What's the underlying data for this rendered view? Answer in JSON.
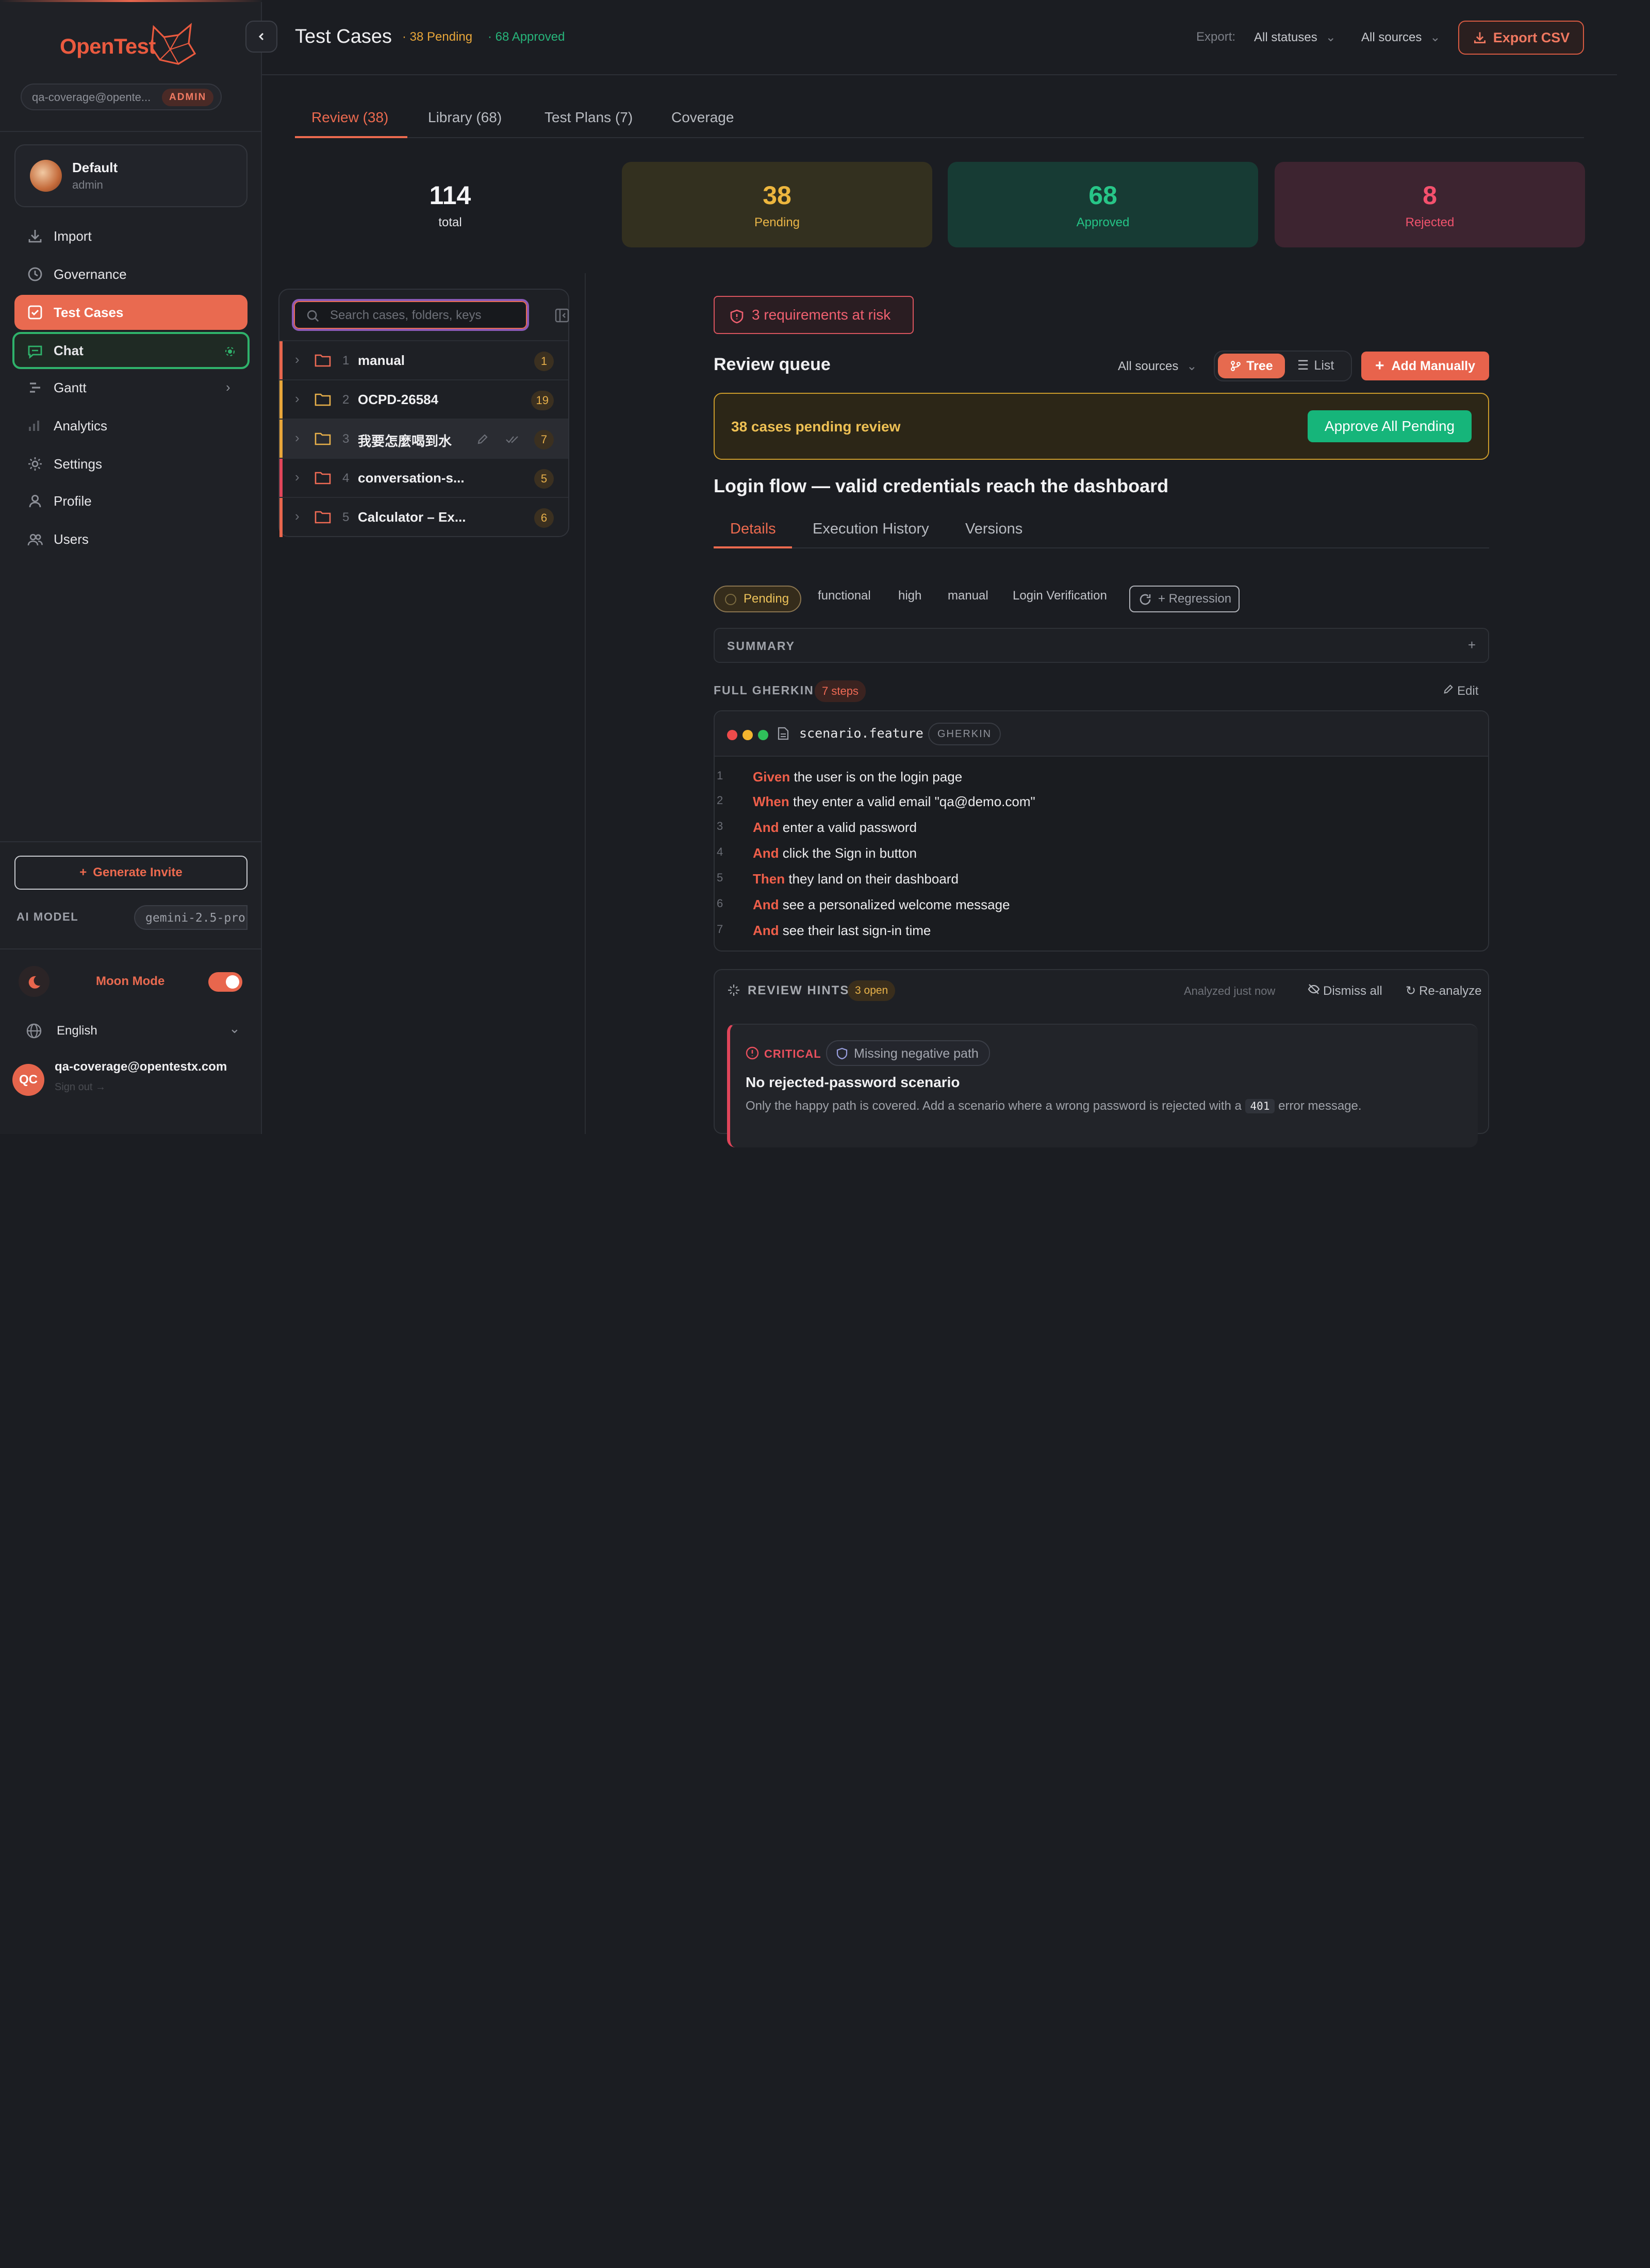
{
  "app": {
    "name": "OpenTest",
    "user_email_short": "qa-coverage@opente...",
    "role_badge": "ADMIN"
  },
  "workspace": {
    "name": "Default",
    "role": "admin"
  },
  "nav": [
    {
      "label": "Import",
      "icon": "download-icon"
    },
    {
      "label": "Governance",
      "icon": "clock-icon"
    },
    {
      "label": "Test Cases",
      "icon": "checkbox-icon"
    },
    {
      "label": "Chat",
      "icon": "chat-icon"
    },
    {
      "label": "Gantt",
      "icon": "gantt-icon"
    },
    {
      "label": "Analytics",
      "icon": "bar-chart-icon"
    },
    {
      "label": "Settings",
      "icon": "gear-icon"
    },
    {
      "label": "Profile",
      "icon": "person-icon"
    },
    {
      "label": "Users",
      "icon": "users-icon"
    }
  ],
  "sidebar_footer": {
    "generate_invite": "Generate Invite",
    "ai_model_label": "AI MODEL",
    "ai_model_value": "gemini-2.5-pro",
    "moon_mode": "Moon Mode",
    "moon_mode_on": true,
    "language": "English",
    "user_initials": "QC",
    "user_email": "qa-coverage@opentestx.com",
    "sign_out": "Sign out →"
  },
  "header": {
    "title": "Test Cases",
    "pending": "· 38 Pending",
    "approved": "· 68 Approved",
    "export_label": "Export:",
    "status_filter": "All statuses",
    "source_filter": "All sources",
    "export_button": "Export CSV"
  },
  "tabs": [
    "Review (38)",
    "Library (68)",
    "Test Plans (7)",
    "Coverage"
  ],
  "stats": [
    {
      "value": "114",
      "label": "total"
    },
    {
      "value": "38",
      "label": "Pending"
    },
    {
      "value": "68",
      "label": "Approved"
    },
    {
      "value": "8",
      "label": "Rejected"
    }
  ],
  "tree": {
    "search_placeholder": "Search cases, folders, keys",
    "folders": [
      {
        "index": "1",
        "name": "manual",
        "count": "1"
      },
      {
        "index": "2",
        "name": "OCPD-26584",
        "count": "19"
      },
      {
        "index": "3",
        "name": "我要怎麼喝到水",
        "count": "7"
      },
      {
        "index": "4",
        "name": "conversation-s...",
        "count": "5"
      },
      {
        "index": "5",
        "name": "Calculator – Ex...",
        "count": "6"
      }
    ]
  },
  "review": {
    "risk": "3 requirements at risk",
    "queue_title": "Review queue",
    "sources": "All sources",
    "tree_view": "Tree",
    "list_view": "List",
    "add_manually": "Add Manually",
    "banner_text": "38 cases pending review",
    "approve_all": "Approve All Pending"
  },
  "case": {
    "title": "Login flow — valid credentials reach the dashboard",
    "tabs": [
      "Details",
      "Execution History",
      "Versions"
    ],
    "status": "Pending",
    "tags": [
      "functional",
      "high",
      "manual",
      "Login Verification"
    ],
    "regression": "+ Regression",
    "summary_label": "SUMMARY",
    "summary_add": "+",
    "gherkin_label": "FULL GHERKIN",
    "steps_badge": "7 steps",
    "edit": "Edit",
    "file_name": "scenario.feature",
    "lang_badge": "GHERKIN",
    "lines": [
      {
        "n": "1",
        "kw": "Given",
        "text": " the user is on the login page"
      },
      {
        "n": "2",
        "kw": "When",
        "text": " they enter a valid email \"qa@demo.com\""
      },
      {
        "n": "3",
        "kw": "And",
        "text": " enter a valid password"
      },
      {
        "n": "4",
        "kw": "And",
        "text": " click the Sign in button"
      },
      {
        "n": "5",
        "kw": "Then",
        "text": " they land on their dashboard"
      },
      {
        "n": "6",
        "kw": "And",
        "text": " see a personalized welcome message"
      },
      {
        "n": "7",
        "kw": "And",
        "text": " see their last sign-in time"
      }
    ]
  },
  "hints": {
    "title": "REVIEW HINTS",
    "open": "3 open",
    "analyzed": "Analyzed just now",
    "dismiss": "Dismiss all",
    "reanalyze": "Re-analyze",
    "severity": "CRITICAL",
    "category": "Missing negative path",
    "heading": "No rejected-password scenario",
    "desc_before": "Only the happy path is covered. Add a scenario where a wrong password is rejected with a ",
    "code": "401",
    "desc_after": " error message."
  },
  "colors": {
    "accent": "#e96a50",
    "pending": "#e8a63a",
    "approved": "#27b47a",
    "rejected": "#f0506a",
    "chat_border": "#2fb36b"
  }
}
